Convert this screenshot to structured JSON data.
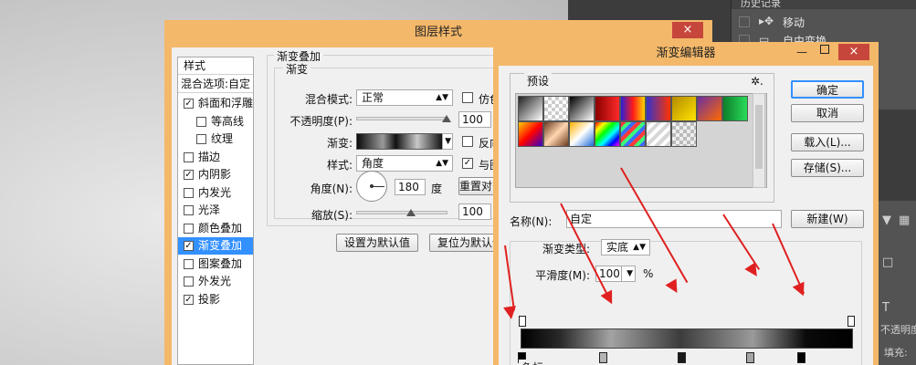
{
  "history": {
    "tab_label": "历史记录",
    "items": [
      {
        "label": "移动"
      },
      {
        "label": "自由变换"
      }
    ]
  },
  "right_panel": {
    "opacity_label": "不透明度:",
    "fill_label": "填充:"
  },
  "layer_style": {
    "title": "图层样式",
    "close_icon": "×",
    "styles_header": "样式",
    "blend_options": "混合选项:自定",
    "items": [
      {
        "label": "斜面和浮雕",
        "checked": true
      },
      {
        "label": "等高线",
        "checked": false
      },
      {
        "label": "纹理",
        "checked": false
      },
      {
        "label": "描边",
        "checked": false
      },
      {
        "label": "内阴影",
        "checked": true
      },
      {
        "label": "内发光",
        "checked": false
      },
      {
        "label": "光泽",
        "checked": false
      },
      {
        "label": "颜色叠加",
        "checked": false
      },
      {
        "label": "渐变叠加",
        "checked": true,
        "selected": true
      },
      {
        "label": "图案叠加",
        "checked": false
      },
      {
        "label": "外发光",
        "checked": false
      },
      {
        "label": "投影",
        "checked": true
      }
    ],
    "panel_title": "渐变叠加",
    "group_title": "渐变",
    "blend_mode_label": "混合模式:",
    "blend_mode_value": "正常",
    "dither_label": "仿色",
    "opacity_label": "不透明度(P):",
    "opacity_value": "100",
    "gradient_label": "渐变:",
    "reverse_label": "反向",
    "style_label": "样式:",
    "style_value": "角度",
    "align_label": "与图",
    "angle_label": "角度(N):",
    "angle_value": "180",
    "angle_unit": "度",
    "reset_align_button": "重置对齐",
    "scale_label": "缩放(S):",
    "scale_value": "100",
    "set_default_button": "设置为默认值",
    "reset_default_button": "复位为默认值"
  },
  "gradient_editor": {
    "title": "渐变编辑器",
    "minimize_icon": "—",
    "close_icon": "×",
    "presets_label": "预设",
    "gear_icon": "✲.",
    "ok_button": "确定",
    "cancel_button": "取消",
    "load_button": "载入(L)...",
    "save_button": "存储(S)...",
    "name_label": "名称(N):",
    "name_value": "自定",
    "new_button": "新建(W)",
    "type_label": "渐变类型:",
    "type_value": "实底",
    "smoothness_label": "平滑度(M):",
    "smoothness_value": "100",
    "smoothness_unit": "%",
    "color_stops_label": "色标"
  }
}
